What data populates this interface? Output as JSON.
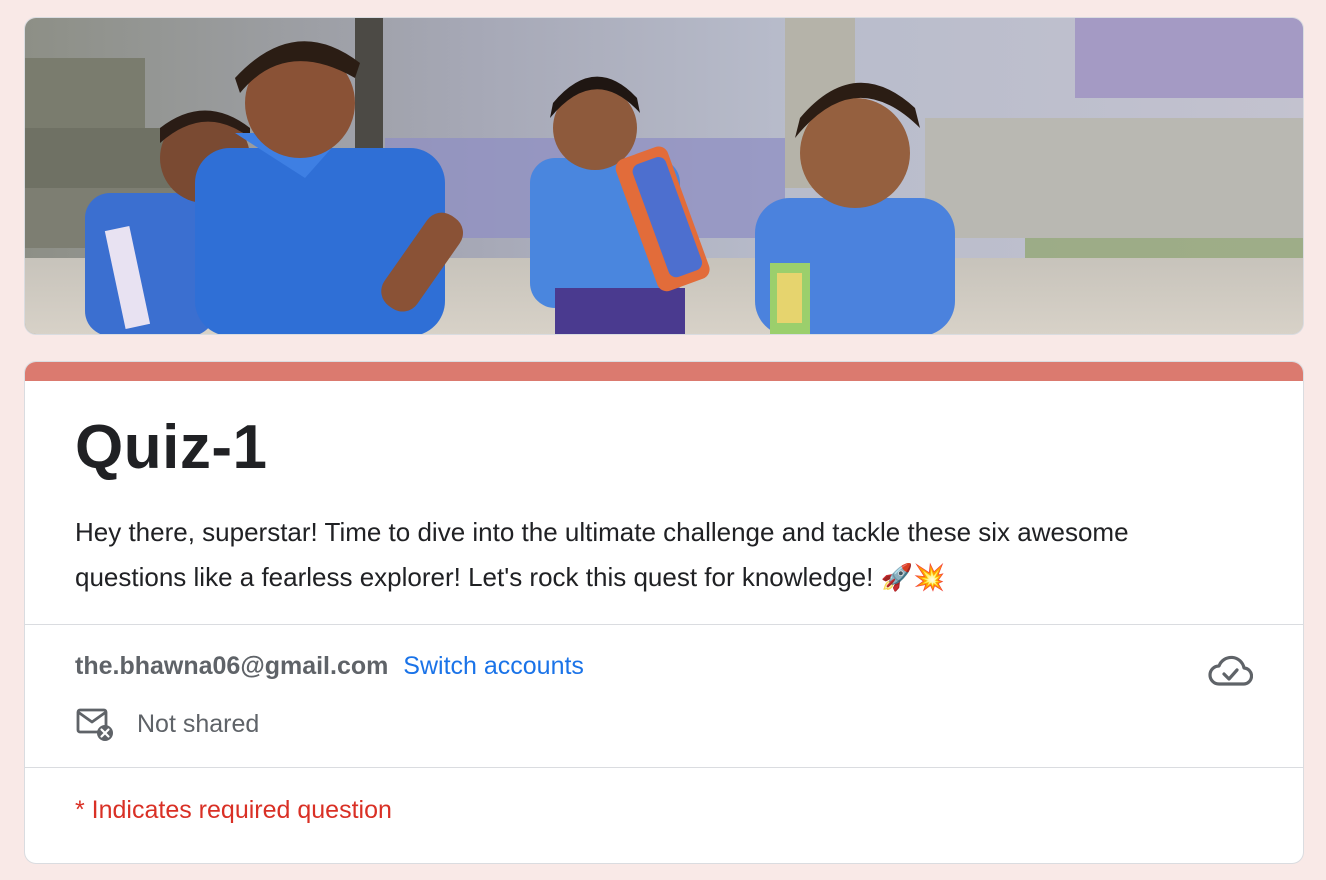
{
  "form": {
    "title": "Quiz-1",
    "description": "Hey there, superstar! Time to dive into the ultimate challenge and tackle these six awesome questions like a fearless explorer! Let's rock this quest for knowledge! 🚀💥",
    "account_email": "the.bhawna06@gmail.com",
    "switch_accounts_label": "Switch accounts",
    "sharing_status": "Not shared",
    "required_note": "* Indicates required question"
  },
  "icons": {
    "header_image": "children-in-school-uniforms-photo",
    "cloud": "cloud-check-icon",
    "mail": "mail-not-shared-icon"
  },
  "colors": {
    "page_background": "#f9e9e7",
    "accent": "#db7a6f",
    "link": "#1a73e8",
    "required": "#d93025",
    "text": "#202124",
    "secondary_text": "#5f6368"
  }
}
